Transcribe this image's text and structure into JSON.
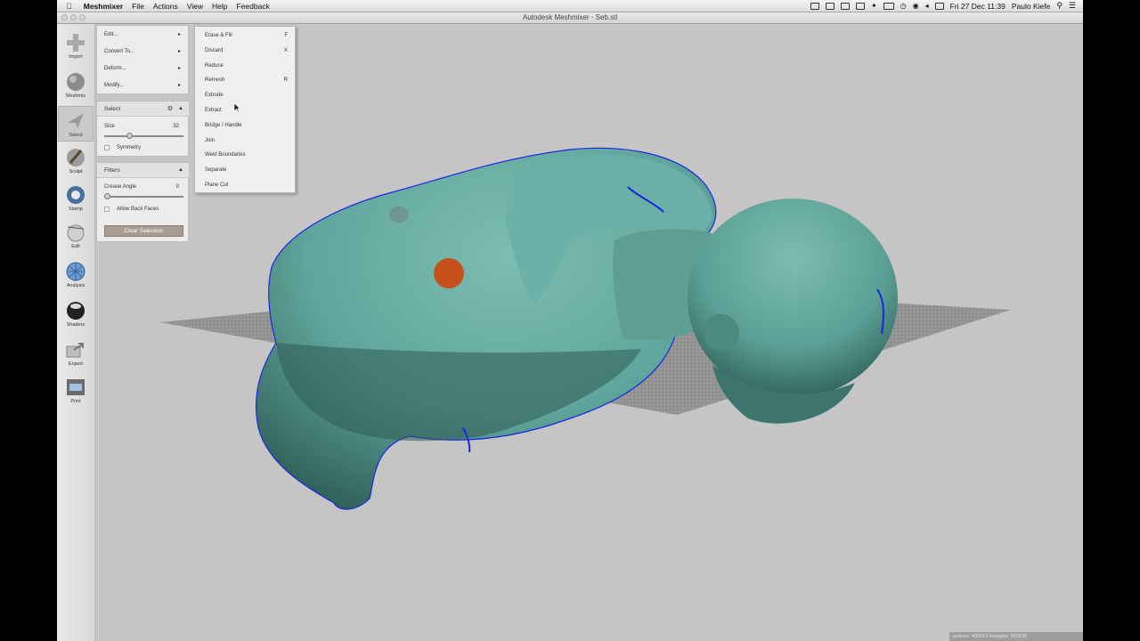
{
  "menubar": {
    "app_name": "Meshmixer",
    "menus": [
      "File",
      "Actions",
      "View",
      "Help",
      "Feedback"
    ],
    "clock": "Fri 27 Dec  11:39",
    "user": "Paulo Kiefe"
  },
  "window": {
    "title": "Autodesk Meshmixer - Seb.stl"
  },
  "toolbar": {
    "tools": [
      {
        "label": "Import",
        "icon": "plus-icon"
      },
      {
        "label": "Meshmix",
        "icon": "meshmix-sphere-icon"
      },
      {
        "label": "Select",
        "icon": "select-arrow-icon",
        "active": true
      },
      {
        "label": "Sculpt",
        "icon": "sculpt-brush-icon"
      },
      {
        "label": "Stamp",
        "icon": "stamp-icon"
      },
      {
        "label": "Edit",
        "icon": "edit-sphere-icon"
      },
      {
        "label": "Analysis",
        "icon": "analysis-icon"
      },
      {
        "label": "Shaders",
        "icon": "shader-sphere-icon"
      },
      {
        "label": "Export",
        "icon": "export-icon"
      },
      {
        "label": "Print",
        "icon": "print-icon"
      }
    ]
  },
  "context_menu": {
    "items": [
      "Edit...",
      "Convert To...",
      "Deform...",
      "Modify..."
    ]
  },
  "select_panel": {
    "title": "Select",
    "size_label": "Size",
    "size_value": "32",
    "size_fraction": 0.32,
    "symmetry_label": "Symmetry"
  },
  "filters_panel": {
    "title": "Filters",
    "crease_label": "Crease Angle",
    "crease_value": "0",
    "crease_fraction": 0.0,
    "back_faces_label": "Allow Back Faces",
    "clear_button": "Clear Selection"
  },
  "edit_submenu": {
    "items": [
      {
        "label": "Erase & Fill",
        "shortcut": "F"
      },
      {
        "label": "Discard",
        "shortcut": "X"
      },
      {
        "label": "Reduce",
        "shortcut": ""
      },
      {
        "label": "Remesh",
        "shortcut": "R"
      },
      {
        "label": "Extrude",
        "shortcut": ""
      },
      {
        "label": "Extract",
        "shortcut": ""
      },
      {
        "label": "Bridge / Handle",
        "shortcut": ""
      },
      {
        "label": "Join",
        "shortcut": ""
      },
      {
        "label": "Weld Boundaries",
        "shortcut": ""
      },
      {
        "label": "Separate",
        "shortcut": ""
      },
      {
        "label": "Plane Cut",
        "shortcut": ""
      }
    ]
  },
  "status": {
    "text": "vertices: 400913  triangles: 855539"
  },
  "colors": {
    "mesh": "#5fa59b",
    "selection": "#c6501c",
    "boundary": "#1a28e0",
    "viewport": "#c5c5c5"
  }
}
